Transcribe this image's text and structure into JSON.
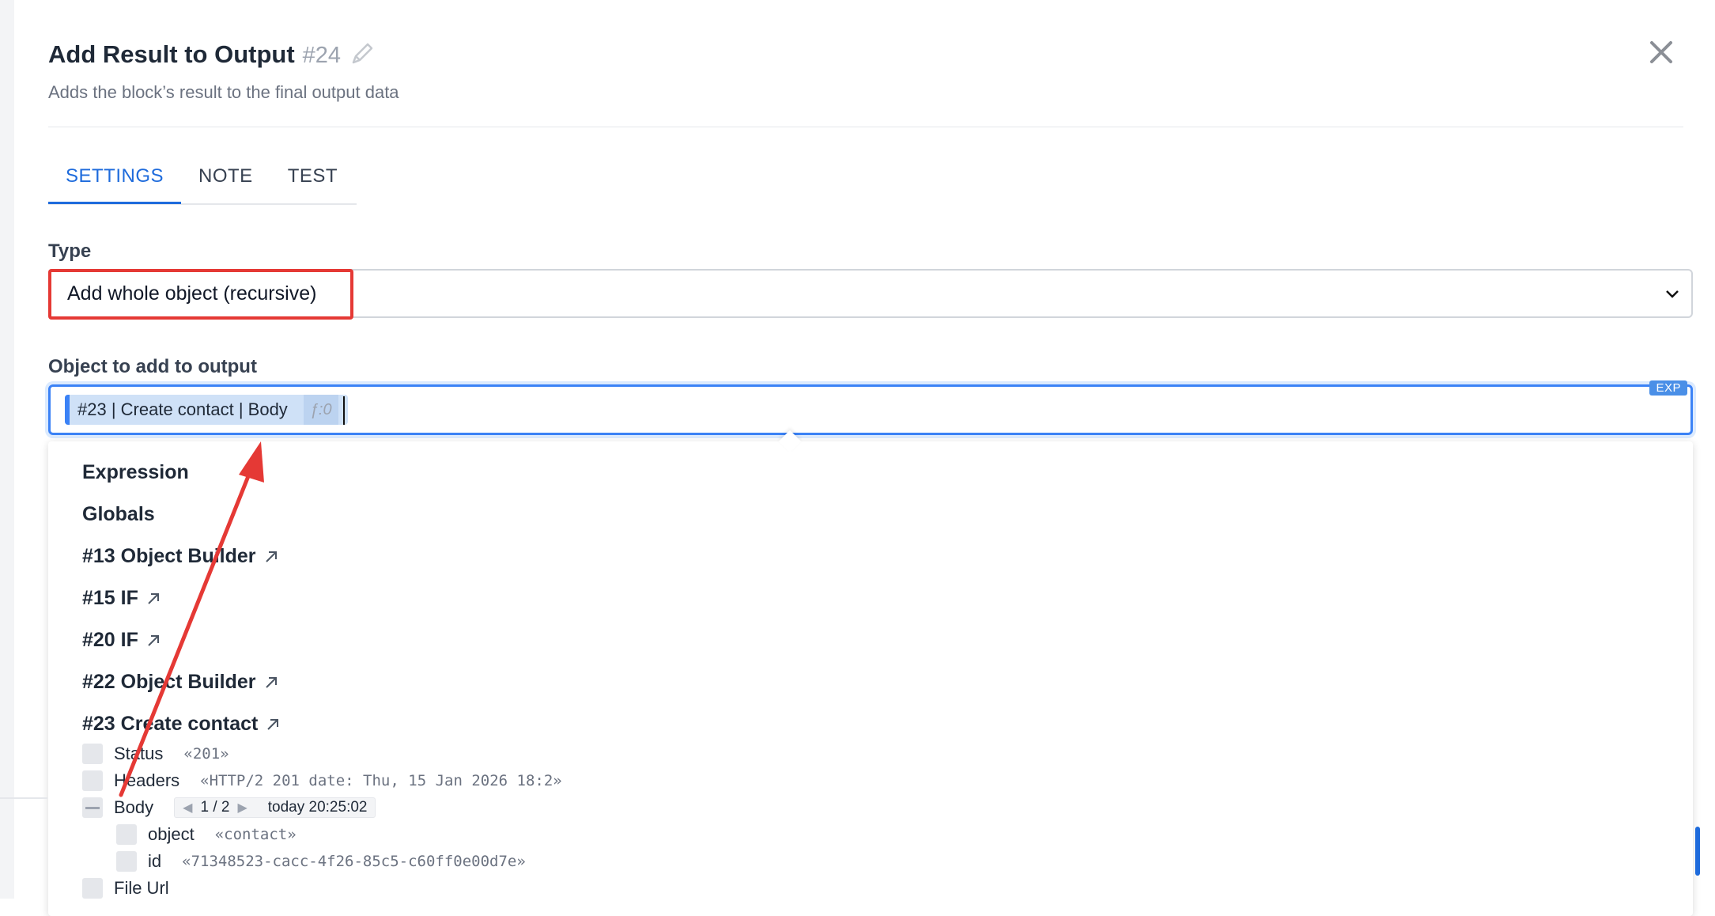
{
  "header": {
    "title": "Add Result to Output",
    "block_id": "#24",
    "subtitle": "Adds the block’s result to the final output data"
  },
  "tabs": [
    {
      "label": "SETTINGS",
      "active": true
    },
    {
      "label": "NOTE",
      "active": false
    },
    {
      "label": "TEST",
      "active": false
    }
  ],
  "type_field": {
    "label": "Type",
    "value": "Add whole object (recursive)"
  },
  "object_field": {
    "label": "Object to add to output",
    "chip_label": "#23 | Create contact | Body",
    "chip_count": "ƒ:0",
    "badge": "EXP"
  },
  "dropdown": {
    "items": [
      {
        "label": "Expression",
        "external": false
      },
      {
        "label": "Globals",
        "external": false
      },
      {
        "label": "#13 Object Builder",
        "external": true
      },
      {
        "label": "#15 IF",
        "external": true
      },
      {
        "label": "#20 IF",
        "external": true
      },
      {
        "label": "#22 Object Builder",
        "external": true
      },
      {
        "label": "#23 Create contact",
        "external": true
      }
    ],
    "tree": {
      "status": {
        "key": "Status",
        "value": "«201»"
      },
      "headers": {
        "key": "Headers",
        "value": "«HTTP/2 201 date: Thu, 15 Jan 2026 18:2»"
      },
      "body": {
        "key": "Body",
        "page": "1 / 2",
        "timestamp": "today 20:25:02"
      },
      "object": {
        "key": "object",
        "value": "«contact»"
      },
      "id": {
        "key": "id",
        "value": "«71348523-cacc-4f26-85c5-c60ff0e00d7e»"
      },
      "file_url": {
        "key": "File Url"
      }
    }
  },
  "colors": {
    "accent": "#1e6bdc",
    "highlight": "#e53935",
    "chip_bg": "#cfe1f7"
  }
}
